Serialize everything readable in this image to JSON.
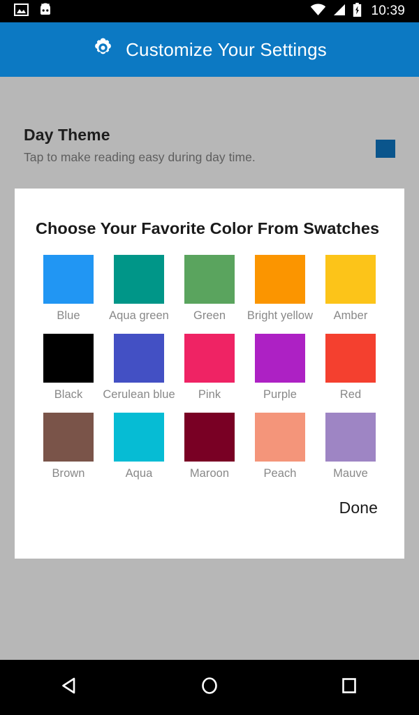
{
  "status_bar": {
    "time": "10:39",
    "left_icons": [
      "image-icon",
      "android-head-icon"
    ],
    "right_icons": [
      "wifi-icon",
      "cellular-signal-icon",
      "battery-charging-icon"
    ],
    "background": "#000000"
  },
  "app_bar": {
    "icon": "gear-icon",
    "title": "Customize Your Settings",
    "background": "#0c79c3",
    "text_color": "#ffffff"
  },
  "setting": {
    "title": "Day Theme",
    "subtitle": "Tap to make reading easy during day time.",
    "indicator_color": "#0a558c"
  },
  "dialog": {
    "title": "Choose Your Favorite Color From Swatches",
    "done_label": "Done",
    "background": "#ffffff",
    "swatches": [
      [
        {
          "label": "Blue",
          "color": "#2196f3"
        },
        {
          "label": "Aqua green",
          "color": "#009688"
        },
        {
          "label": "Green",
          "color": "#5aa45e"
        },
        {
          "label": "Bright yellow",
          "color": "#fb9500"
        },
        {
          "label": "Amber",
          "color": "#fcc419"
        }
      ],
      [
        {
          "label": "Black",
          "color": "#000000"
        },
        {
          "label": "Cerulean blue",
          "color": "#4350c4"
        },
        {
          "label": "Pink",
          "color": "#ef2364"
        },
        {
          "label": "Purple",
          "color": "#ad21c4"
        },
        {
          "label": "Red",
          "color": "#f4402f"
        }
      ],
      [
        {
          "label": "Brown",
          "color": "#7a5449"
        },
        {
          "label": "Aqua",
          "color": "#06bcd4"
        },
        {
          "label": "Maroon",
          "color": "#790024"
        },
        {
          "label": "Peach",
          "color": "#f4957a"
        },
        {
          "label": "Mauve",
          "color": "#9e85c4"
        }
      ]
    ]
  },
  "nav_bar": {
    "background": "#000000",
    "buttons": [
      {
        "name": "back-button",
        "icon": "back-triangle-icon"
      },
      {
        "name": "home-button",
        "icon": "home-circle-icon"
      },
      {
        "name": "recents-button",
        "icon": "recents-square-icon"
      }
    ]
  },
  "page": {
    "background": "#b7b7b7"
  }
}
